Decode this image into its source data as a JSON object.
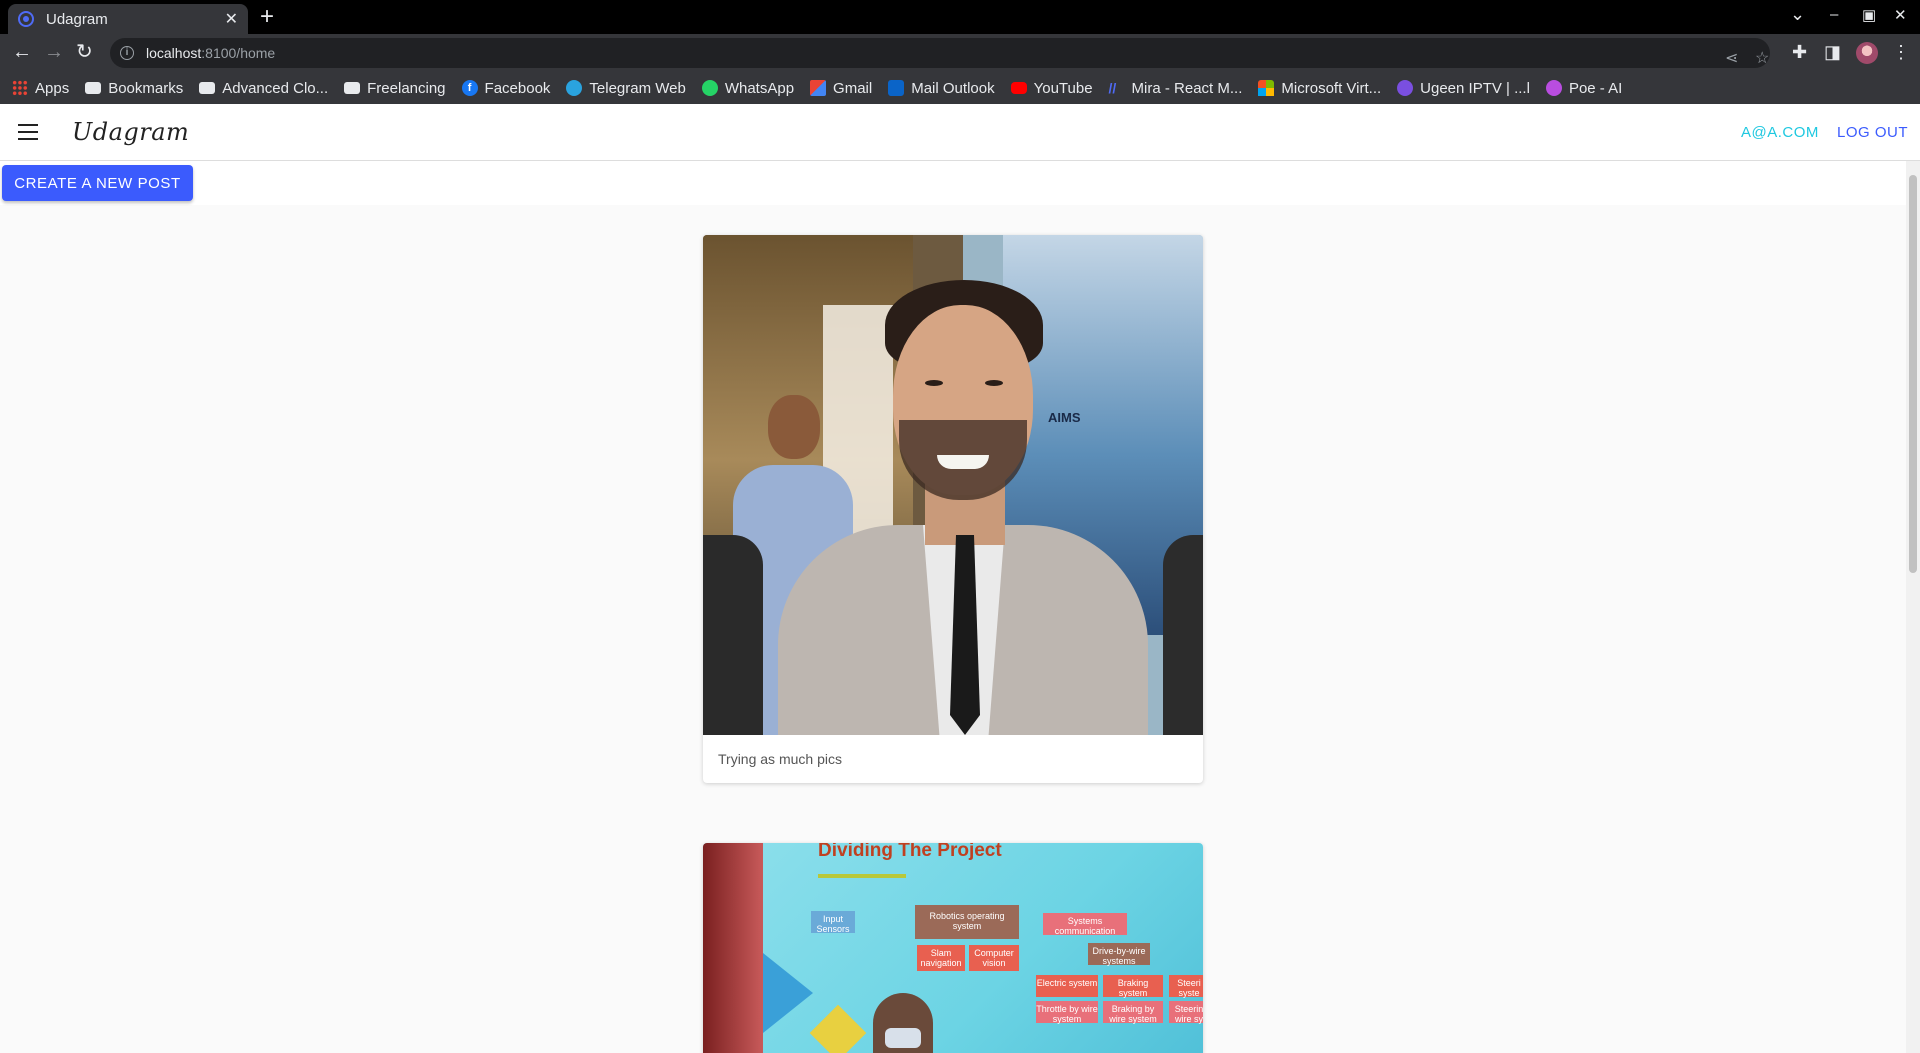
{
  "browser": {
    "tab_title": "Udagram",
    "tab_close": "✕",
    "new_tab": "+",
    "url_host": "localhost",
    "url_path": ":8100/home",
    "window_controls": {
      "chevron": "⌄",
      "minimize": "–",
      "maximize": "▣",
      "close": "✕"
    },
    "bookmarks": [
      {
        "label": "Apps",
        "icon": "apps-icon"
      },
      {
        "label": "Bookmarks",
        "icon": "folder-icon"
      },
      {
        "label": "Advanced Clo...",
        "icon": "folder-icon"
      },
      {
        "label": "Freelancing",
        "icon": "folder-icon"
      },
      {
        "label": "Facebook",
        "icon": "facebook-icon"
      },
      {
        "label": "Telegram Web",
        "icon": "telegram-icon"
      },
      {
        "label": "WhatsApp",
        "icon": "whatsapp-icon"
      },
      {
        "label": "Gmail",
        "icon": "gmail-icon"
      },
      {
        "label": "Mail Outlook",
        "icon": "outlook-icon"
      },
      {
        "label": "YouTube",
        "icon": "youtube-icon"
      },
      {
        "label": "Mira - React M...",
        "icon": "mira-icon"
      },
      {
        "label": "Microsoft Virt...",
        "icon": "microsoft-icon"
      },
      {
        "label": "Ugeen IPTV | ...l",
        "icon": "ugeen-icon"
      },
      {
        "label": "Poe - AI",
        "icon": "poe-icon"
      }
    ]
  },
  "app": {
    "brand": "Udagram",
    "user_email": "A@A.COM",
    "logout_label": "LOG OUT",
    "create_post_label": "CREATE A NEW POST"
  },
  "feed": {
    "posts": [
      {
        "caption": "Trying as much pics",
        "image": "photo-portrait-man-in-suit"
      },
      {
        "caption": "",
        "image": "photo-project-presentation",
        "slide_heading": "Dividing The Project",
        "slide_boxes": [
          "Input Sensors",
          "Robotics operating system",
          "Slam navigation",
          "Computer vision",
          "Systems communication",
          "Drive-by-wire systems",
          "Electric system",
          "Braking system",
          "Steeri syste",
          "Throttle by wire system",
          "Braking by wire system",
          "Steerin wire sy"
        ]
      }
    ]
  },
  "photo1_poster_text": "AIMS",
  "colors": {
    "accent": "#3b5bfd",
    "email_link": "#1ec8e0",
    "chrome_dark": "#35363a"
  }
}
